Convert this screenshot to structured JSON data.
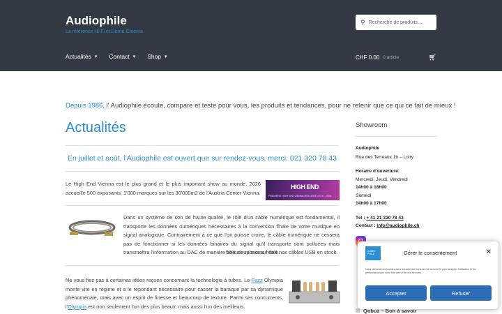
{
  "header": {
    "site_title": "Audiophile",
    "site_description": "La référence Hi-Fi et Home-Cinéma",
    "search_placeholder": "Recherche de produits…",
    "nav": [
      {
        "label": "Actualités"
      },
      {
        "label": "Contact"
      },
      {
        "label": "Shop"
      }
    ],
    "cart_total": "CHF 0.00",
    "cart_count": "0 article"
  },
  "main": {
    "tagline_accent": "Depuis 1986,",
    "tagline_rest": " l' Audiophile écoute, compare et teste pour vous, les produits et tendances, pour ne retenir que ce qui ce fait de mieux !",
    "page_title": "Actualités",
    "notice": "En juillet et août, l'Audiophile est ouvert que sur rendez-vous, merci. 021 320 78 43",
    "article1": {
      "text": "Le High End Vienna est le plus grand et le plus important show au monde. 2026 accueille 500 exposants, 1'000 marques sur les 30'000m2 de l'Austria Center Vienna.",
      "banner_title": "HIGH END",
      "banner_sub": "PREMIÈRE HIGH END VIENNA 2026    JUNE 4 TO 7, 2026"
    },
    "article2": {
      "text": "Dans un système de son de haute qualité, le rôle d'un câble numérique est fondamental, il transporte les données numériques nécessaires à la conversion finale de votre musique en signal analogique. Contrairement à ce que l'on puisse croire, le câble numérique ne cessera pas de fonctionner si les données binaires du signal qu'il transporte sont polluées mais transmettra l'information au DAC de manière beaucoup moins fidèle.",
      "link": "50% de rabais sur tout nos câbles USB en stock."
    },
    "article3": {
      "text1": "Ne vous fiez pas à certaines idées reçues concernant la technologie à tubes. Le ",
      "link1": "Fezz",
      "text2": " Olympia monte vite en régime et a le répondant nécessaire  pour casser la baraque par sa dynamique phénoménale, mais avec un esprit de finesse et beaucoup de texture. Parmi ses concurrents, l'",
      "link2": "Olympia",
      "text3": " est non seulement l'un des plus beaux, mais aussi l'un des meilleurs."
    }
  },
  "sidebar": {
    "title": "Showroom",
    "name": "Audiophile",
    "address": "Rue des Terreaux 1b – Lutry",
    "hours_title": "Horaire d'ouverture:",
    "days1": "Mercredi, Jeudi, Vendredi",
    "hours1": "14h00 à 18h00",
    "days2": "Samedi",
    "hours2": "14h00 à 17h00",
    "tel_label": "Tél :",
    "tel": "+ 41 21 320 78 43",
    "contact_label": "Contact :",
    "email": "info@audiophile.ch",
    "bottom_item": "Qobuz – Bon à savoir"
  },
  "consent": {
    "logo_text": "AUDIO PHILE",
    "title": "Gérer le consentement",
    "text": "Nous utilisons des cookies dans le cadre des mesures de sécurité et pour analyser l'utilisation et les performances de notre site web et de nos services.",
    "accept": "Accepter",
    "refuse": "Refuser"
  }
}
